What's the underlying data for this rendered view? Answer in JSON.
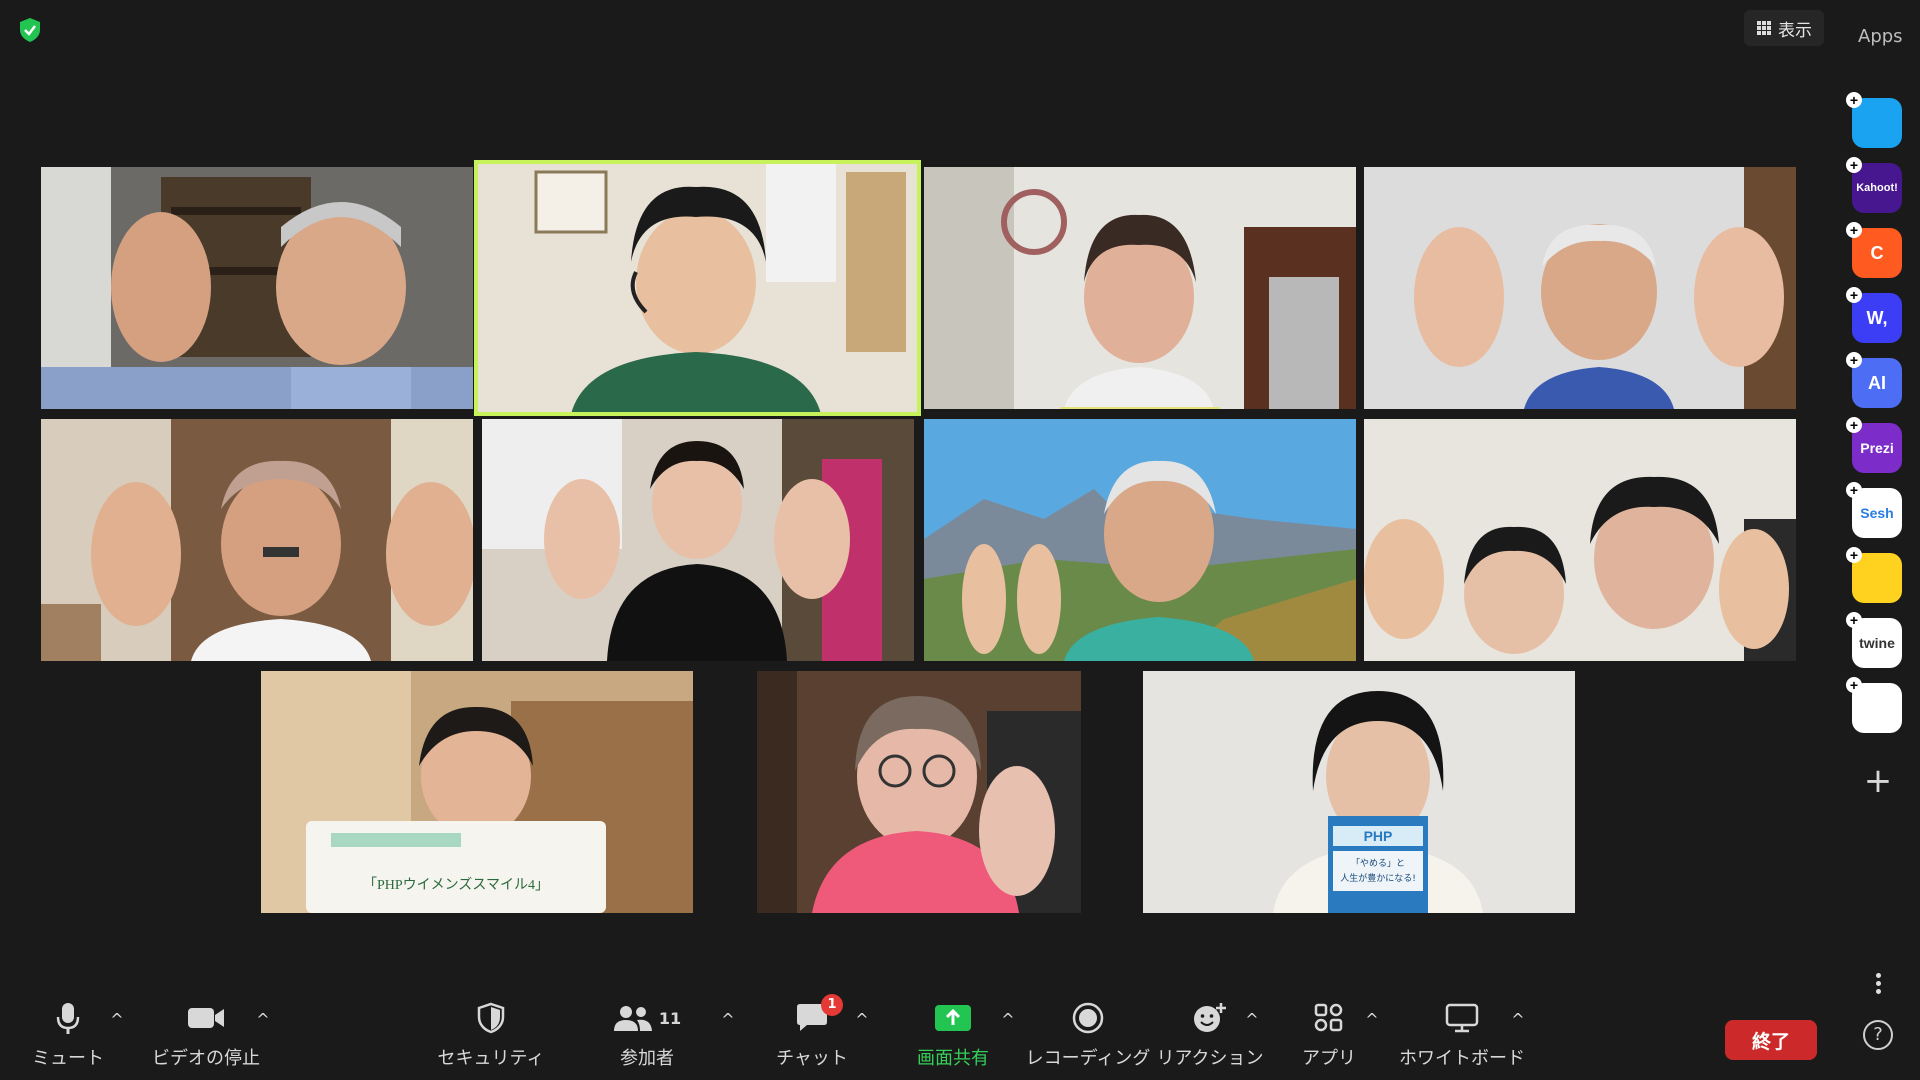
{
  "top": {
    "view_label": "表示",
    "apps_title": "Apps"
  },
  "participants": [
    {
      "name": "participant-1",
      "speaking": false
    },
    {
      "name": "participant-2",
      "speaking": true
    },
    {
      "name": "participant-3",
      "speaking": false
    },
    {
      "name": "participant-4",
      "speaking": false
    },
    {
      "name": "participant-5",
      "speaking": false
    },
    {
      "name": "participant-6",
      "speaking": false
    },
    {
      "name": "participant-7",
      "speaking": false
    },
    {
      "name": "participant-8",
      "speaking": false
    },
    {
      "name": "participant-9",
      "speaking": false
    },
    {
      "name": "participant-10",
      "speaking": false
    },
    {
      "name": "participant-11",
      "speaking": false
    }
  ],
  "book_texts": {
    "p9_title": "「PHPウイメンズスマイル4」",
    "p11_cover": "PHP",
    "p11_line1": "「やめる」と",
    "p11_line2": "人生が豊かになる!"
  },
  "apps": [
    {
      "name": "zoom-app-icon",
      "label": "",
      "bg": "#1aa3f0",
      "fg": "#ffffff"
    },
    {
      "name": "kahoot-app-icon",
      "label": "Kahoot!",
      "bg": "#46178f",
      "fg": "#ffffff"
    },
    {
      "name": "orange-app-icon",
      "label": "C",
      "bg": "#ff5a1f",
      "fg": "#ffffff"
    },
    {
      "name": "wooclap-app-icon",
      "label": "W,",
      "bg": "#3b3ef5",
      "fg": "#ffffff"
    },
    {
      "name": "ai-app-icon",
      "label": "AI",
      "bg": "#4e6df5",
      "fg": "#ffffff"
    },
    {
      "name": "prezi-app-icon",
      "label": "Prezi",
      "bg": "#7b2cc9",
      "fg": "#ffffff"
    },
    {
      "name": "sesh-app-icon",
      "label": "Sesh",
      "bg": "#ffffff",
      "fg": "#2a7de1"
    },
    {
      "name": "emoji-app-icon",
      "label": "",
      "bg": "#ffd21f",
      "fg": "#000000"
    },
    {
      "name": "twine-app-icon",
      "label": "twine",
      "bg": "#ffffff",
      "fg": "#333333"
    },
    {
      "name": "blocks-app-icon",
      "label": "",
      "bg": "#ffffff",
      "fg": "#333333"
    }
  ],
  "toolbar": {
    "mute": "ミュート",
    "stop_video": "ビデオの停止",
    "security": "セキュリティ",
    "participants": "参加者",
    "participants_count": "11",
    "chat": "チャット",
    "chat_badge": "1",
    "share": "画面共有",
    "record": "レコーディング",
    "reactions": "リアクション",
    "apps": "アプリ",
    "whiteboard": "ホワイトボード",
    "end": "終了",
    "help": "?"
  },
  "colors": {
    "background": "#1a1a1a",
    "speaking_border": "#c8f25a",
    "share_green": "#35d05a",
    "end_red": "#cc2a2a"
  }
}
